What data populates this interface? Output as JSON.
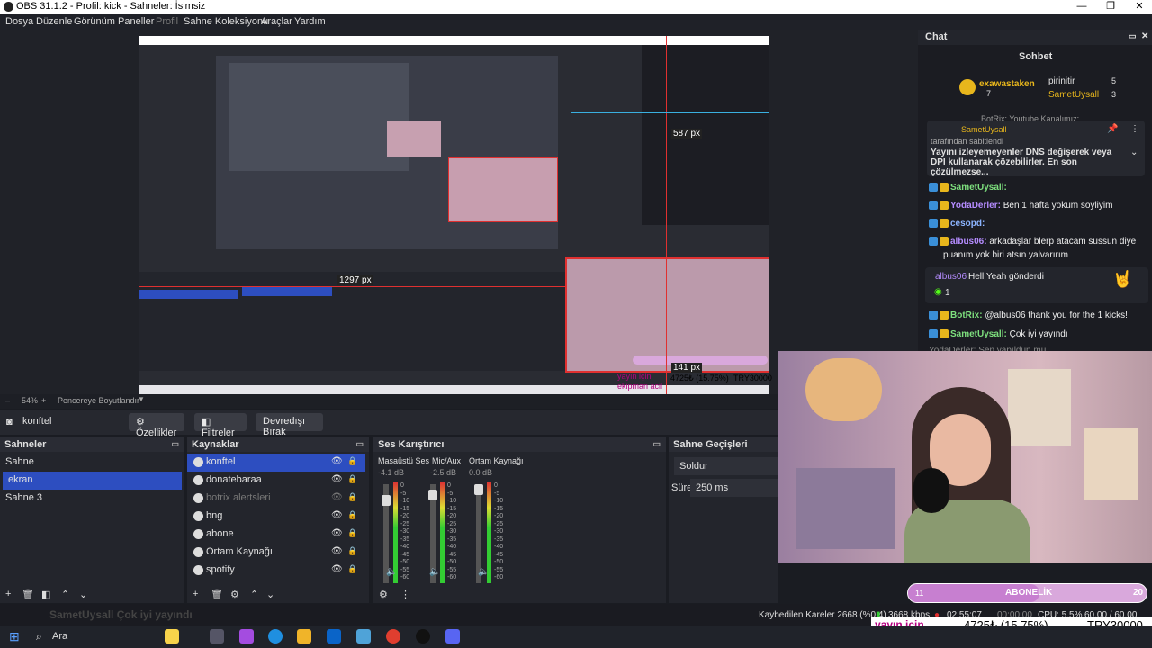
{
  "window": {
    "title": "OBS 31.1.2 - Profil: kick - Sahneler: İsimsiz",
    "controls": [
      "—",
      "❐",
      "✕"
    ]
  },
  "menu": [
    "Dosya",
    "Düzenle",
    "Görünüm",
    "Paneller",
    "Profil",
    "Sahne Koleksiyonu",
    "Araçlar",
    "Yardım"
  ],
  "preview": {
    "zoom_left": "–",
    "zoom": "54%",
    "zoom_right": "+",
    "fit": "Pencereye Boyutlandır",
    "size_label_top": "587 px",
    "size_label_left": "1297 px",
    "size_label_bottom": "141 px"
  },
  "toolbar": {
    "source_name": "konftel",
    "properties": "Özellikler",
    "filters": "Filtreler",
    "deactivate": "Devredışı Bırak"
  },
  "scenes": {
    "title": "Sahneler",
    "items": [
      "Sahne",
      "ekran",
      "Sahne 3"
    ],
    "selected": 1
  },
  "sources": {
    "title": "Kaynaklar",
    "items": [
      {
        "name": "konftel",
        "icon": "camera-icon",
        "dim": false
      },
      {
        "name": "donatebaraa",
        "icon": "globe-icon",
        "dim": false
      },
      {
        "name": "botrix alertsleri",
        "icon": "globe-icon",
        "dim": true
      },
      {
        "name": "bng",
        "icon": "globe-icon",
        "dim": false
      },
      {
        "name": "abone",
        "icon": "globe-icon",
        "dim": false
      },
      {
        "name": "Ortam Kaynağı",
        "icon": "play-icon",
        "dim": false
      },
      {
        "name": "spotify",
        "icon": "globe-icon",
        "dim": false
      }
    ]
  },
  "mixer": {
    "title": "Ses Karıştırıcı",
    "channels": [
      {
        "name": "Masaüstü Ses",
        "db": "-4.1 dB"
      },
      {
        "name": "Mic/Aux",
        "db": "-2.5 dB"
      },
      {
        "name": "Ortam Kaynağı",
        "db": "0.0 dB"
      }
    ],
    "ticks": [
      "0",
      "-5",
      "-10",
      "-15",
      "-20",
      "-25",
      "-30",
      "-35",
      "-40",
      "-45",
      "-50",
      "-55",
      "-60"
    ]
  },
  "transitions": {
    "title": "Sahne Geçişleri",
    "type": "Soldur",
    "duration_label": "Süre",
    "duration": "250 ms"
  },
  "chat": {
    "dock_title": "Chat",
    "header": "Sohbet",
    "top": [
      {
        "name": "exawastaken",
        "count": "7"
      },
      {
        "name": "pirinitir",
        "count": "5"
      },
      {
        "name": "SametUysall",
        "count": "3"
      }
    ],
    "pinned_by": "SametUysall",
    "pinned_label": "tarafından sabitlendi",
    "pinned_text": "Yayını izleyemeyenler DNS değişerek veya DPI kullanarak çözebilirler. En son çözülmezse...",
    "partial_top": "BotRix: Youtube Kanalımız:",
    "messages": [
      {
        "user": "SametUysall:",
        "text": "",
        "color": "#7ee07e"
      },
      {
        "user": "YodaDerler:",
        "text": "Ben 1 hafta yokum söyliyim",
        "color": "#b58cff"
      },
      {
        "user": "cesopd:",
        "text": "",
        "color": "#8cb4ff"
      },
      {
        "user": "albus06:",
        "text": "arkadaşlar blerp atacam sussun diye",
        "color": "#b58cff"
      },
      {
        "user": "",
        "text": "puanım yok biri atsın yalvarırım",
        "color": "#eee"
      },
      {
        "user": "BotRix:",
        "text": "@albus06 thank you for the 1 kicks!",
        "color": "#7ee07e"
      },
      {
        "user": "SametUysall:",
        "text": "Çok iyi yayındı",
        "color": "#7ee07e"
      }
    ],
    "gift": {
      "user": "albus06",
      "text": "Hell Yeah gönderdi",
      "count": "1"
    },
    "partial_bottom": "YodaDerler: Sen yapıldun mu..."
  },
  "subbar": {
    "left": "11",
    "label": "ABONELİK",
    "right": "20",
    "fill": 0.55
  },
  "overlay_text": {
    "line1": "yayın için",
    "line2": "ekipman acil",
    "amount": "4725₺ (15.75%)",
    "goal": "TRY30000"
  },
  "status": {
    "ghost": "SametUysall  Çok iyi yayındı",
    "dropped": "Kaybedilen Kareler 2668 (%0.4)",
    "bitrate": "3668 kbps",
    "time1": "02:55:07",
    "time2": "00:00:00",
    "cpu": "CPU: 5.5%",
    "fps": "60.00 / 60.00 FPS"
  },
  "taskbar": {
    "search": "Ara"
  },
  "colors": {
    "accent": "#2d4ec0",
    "kick_green": "#53fc18",
    "red_bound": "#e03030"
  }
}
